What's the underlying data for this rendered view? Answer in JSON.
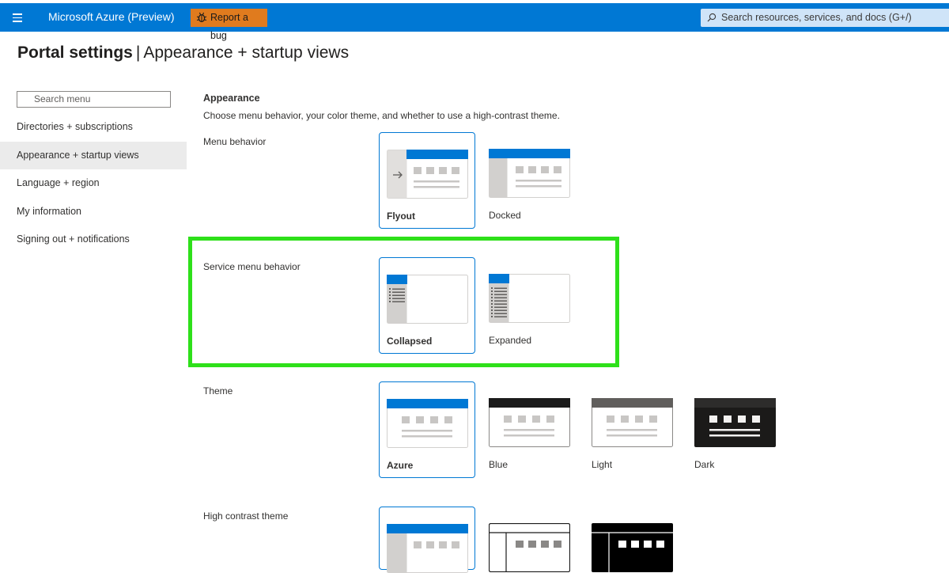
{
  "topbar": {
    "menu_icon": "hamburger-icon",
    "brand": "Microsoft Azure (Preview)",
    "report_bug": "Report a bug",
    "bug_icon": "bug-icon",
    "search_placeholder": "Search resources, services, and docs (G+/)",
    "search_icon": "search-icon",
    "color": "#0078d4",
    "bug_button_color": "#e07b1e"
  },
  "page": {
    "title": "Portal settings",
    "separator": "|",
    "subtitle": "Appearance + startup views"
  },
  "sidebar": {
    "search_placeholder": "Search menu",
    "items": [
      {
        "label": "Directories + subscriptions",
        "active": false
      },
      {
        "label": "Appearance + startup views",
        "active": true
      },
      {
        "label": "Language + region",
        "active": false
      },
      {
        "label": "My information",
        "active": false
      },
      {
        "label": "Signing out + notifications",
        "active": false
      }
    ]
  },
  "appearance": {
    "heading": "Appearance",
    "description": "Choose menu behavior, your color theme, and whether to use a high-contrast theme.",
    "menu_behavior": {
      "label": "Menu behavior",
      "options": [
        {
          "label": "Flyout",
          "selected": true
        },
        {
          "label": "Docked",
          "selected": false
        }
      ]
    },
    "service_menu_behavior": {
      "label": "Service menu behavior",
      "options": [
        {
          "label": "Collapsed",
          "selected": true
        },
        {
          "label": "Expanded",
          "selected": false
        }
      ]
    },
    "theme": {
      "label": "Theme",
      "options": [
        {
          "label": "Azure",
          "selected": true
        },
        {
          "label": "Blue",
          "selected": false
        },
        {
          "label": "Light",
          "selected": false
        },
        {
          "label": "Dark",
          "selected": false
        }
      ]
    },
    "high_contrast_theme": {
      "label": "High contrast theme"
    }
  },
  "colors": {
    "accent": "#0078d4",
    "highlight": "#2ee01a",
    "selected_menu_bg": "#ebebeb"
  }
}
